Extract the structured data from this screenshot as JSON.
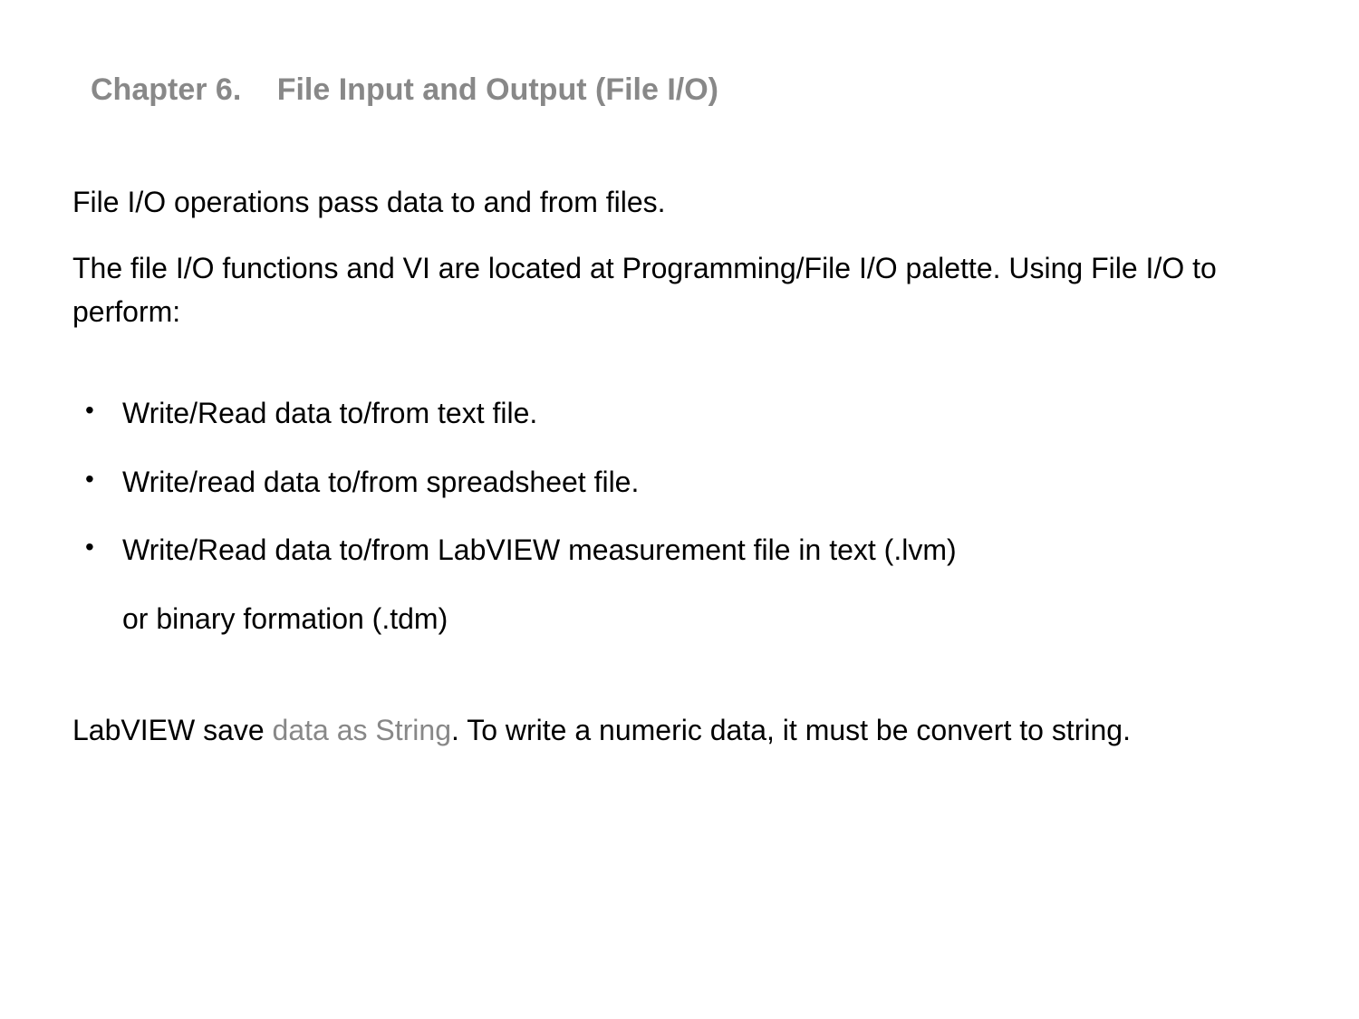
{
  "title": {
    "chapter_num": "Chapter 6.",
    "chapter_name": "File Input and Output  (File I/O)"
  },
  "paragraphs": {
    "intro1": "File I/O operations pass data to and from files.",
    "intro2": "The file I/O functions and VI are located at Programming/File I/O palette.  Using File I/O to perform:"
  },
  "bullets": {
    "item1": "Write/Read data to/from text file.",
    "item2": "Write/read data to/from spreadsheet file.",
    "item3": "Write/Read data to/from LabVIEW measurement file in text (.lvm)",
    "item3_cont": "or  binary formation (.tdm)"
  },
  "closing": {
    "part1": "LabVIEW save ",
    "part2_gray": "data as String",
    "part3": ". To write a numeric data, it must be convert to string."
  }
}
